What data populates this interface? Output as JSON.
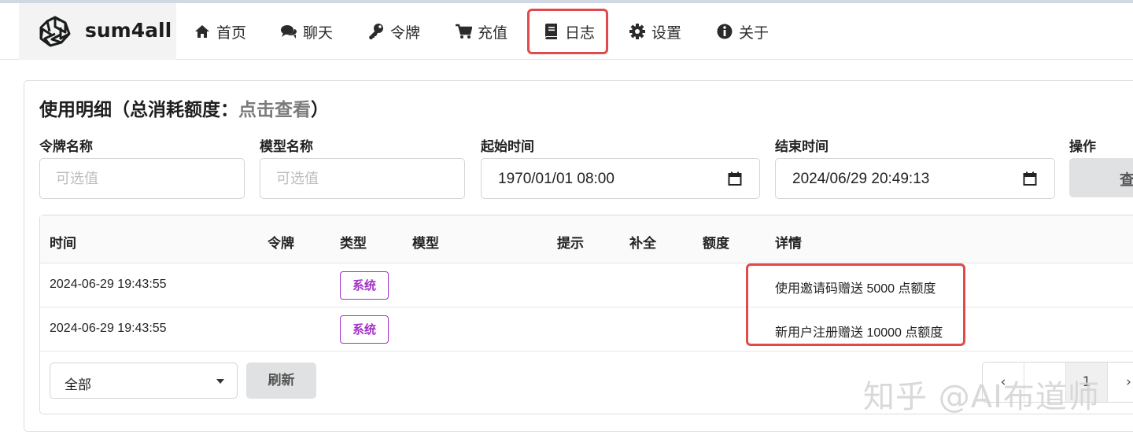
{
  "app": {
    "brand": "sum4all"
  },
  "nav": {
    "items": [
      {
        "label": "首页",
        "icon": "home-icon"
      },
      {
        "label": "聊天",
        "icon": "chat-icon"
      },
      {
        "label": "令牌",
        "icon": "key-icon"
      },
      {
        "label": "充值",
        "icon": "cart-icon"
      },
      {
        "label": "日志",
        "icon": "book-icon"
      },
      {
        "label": "设置",
        "icon": "gear-icon"
      },
      {
        "label": "关于",
        "icon": "info-icon"
      }
    ],
    "highlighted": "日志"
  },
  "page": {
    "title_prefix": "使用明细（总消耗额度：",
    "title_link": "点击查看",
    "title_suffix": "）"
  },
  "filters": {
    "token_name": {
      "label": "令牌名称",
      "placeholder": "可选值",
      "value": ""
    },
    "model_name": {
      "label": "模型名称",
      "placeholder": "可选值",
      "value": ""
    },
    "start_time": {
      "label": "起始时间",
      "value": "1970/01/01 08:00"
    },
    "end_time": {
      "label": "结束时间",
      "value": "2024/06/29 20:49:13"
    },
    "action": {
      "label": "操作",
      "button": "查"
    }
  },
  "table": {
    "headers": [
      "时间",
      "令牌",
      "类型",
      "模型",
      "提示",
      "补全",
      "额度",
      "详情"
    ],
    "rows": [
      {
        "time": "2024-06-29 19:43:55",
        "token": "",
        "type": "系统",
        "model": "",
        "prompt": "",
        "completion": "",
        "quota": "",
        "detail": "使用邀请码赠送 5000 点额度"
      },
      {
        "time": "2024-06-29 19:43:55",
        "token": "",
        "type": "系统",
        "model": "",
        "prompt": "",
        "completion": "",
        "quota": "",
        "detail": "新用户注册赠送 10000 点额度"
      }
    ]
  },
  "footer": {
    "filter_select": "全部",
    "refresh": "刷新",
    "pager": [
      "‹",
      "",
      "1",
      "›"
    ]
  },
  "watermark": "知乎 @AI布道师",
  "colors": {
    "accent_purple": "#a333c8",
    "highlight_red": "#e04a4a",
    "button_gray": "#e0e1e2"
  }
}
